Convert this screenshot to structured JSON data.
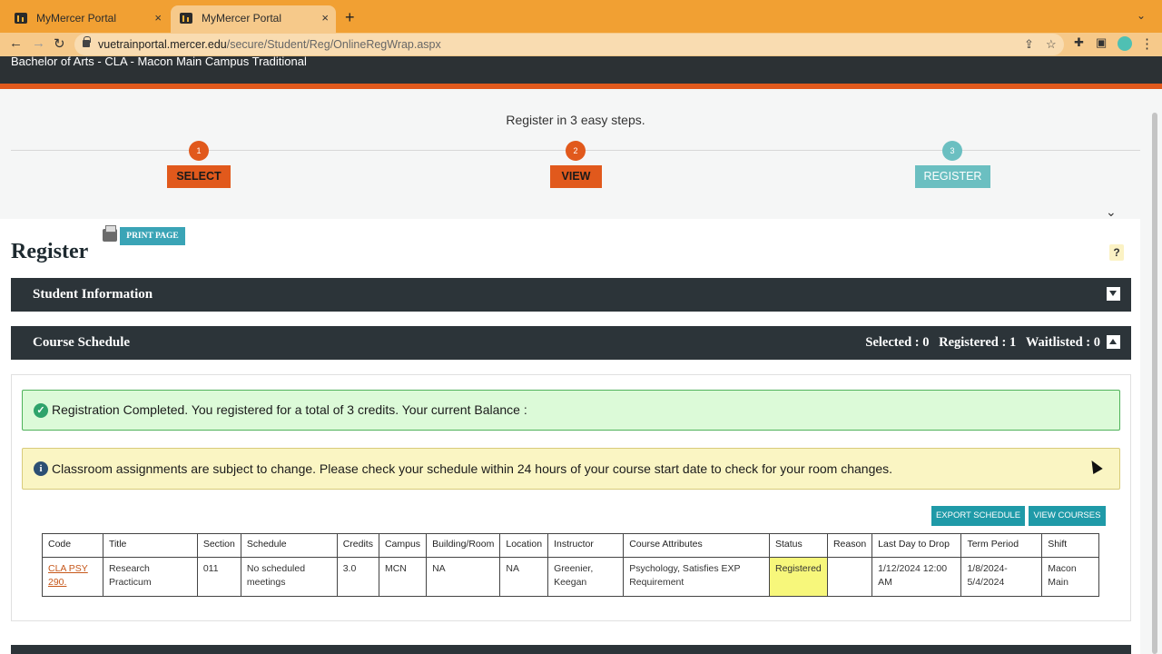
{
  "browser": {
    "tabs": [
      {
        "title": "MyMercer Portal"
      },
      {
        "title": "MyMercer Portal"
      }
    ],
    "new_tab": "+",
    "tab_close": "×",
    "url_host": "vuetrainportal.mercer.edu",
    "url_path": "/secure/Student/Reg/OnlineRegWrap.aspx"
  },
  "header": {
    "program": "Bachelor of Arts - CLA - Macon Main Campus Traditional"
  },
  "steps": {
    "title": "Register in 3 easy steps.",
    "items": [
      {
        "num": "1",
        "label": "SELECT"
      },
      {
        "num": "2",
        "label": "VIEW"
      },
      {
        "num": "3",
        "label": "REGISTER"
      }
    ]
  },
  "page": {
    "print_label": "PRINT PAGE",
    "title": "Register",
    "help": "?"
  },
  "student_info": {
    "title": "Student Information"
  },
  "course_schedule": {
    "title": "Course Schedule",
    "selected": "Selected : 0",
    "registered": "Registered : 1",
    "waitlisted": "Waitlisted : 0"
  },
  "alerts": {
    "success": "Registration Completed. You registered for a total of 3 credits. Your current Balance :",
    "info": "Classroom assignments are subject to change. Please check your schedule within 24 hours of your course start date to check for your room changes."
  },
  "actions": {
    "export": "EXPORT SCHEDULE",
    "view": "VIEW COURSES"
  },
  "table": {
    "headers": [
      "Code",
      "Title",
      "Section",
      "Schedule",
      "Credits",
      "Campus",
      "Building/Room",
      "Location",
      "Instructor",
      "Course Attributes",
      "Status",
      "Reason",
      "Last Day to Drop",
      "Term Period",
      "Shift"
    ],
    "rows": [
      {
        "code": "CLA PSY 290.",
        "title": "Research Practicum",
        "section": "011",
        "schedule": "No scheduled meetings",
        "credits": "3.0",
        "campus": "MCN",
        "building": "NA",
        "location": "NA",
        "instructor": "Greenier, Keegan",
        "attributes": "Psychology, Satisfies EXP Requirement",
        "status": "Registered",
        "reason": "",
        "last_drop": "1/12/2024 12:00 AM",
        "term": "1/8/2024-5/4/2024",
        "shift": "Macon Main"
      }
    ]
  },
  "colors": {
    "accent_orange": "#e1591c",
    "accent_teal": "#6bbfc1",
    "dark_bar": "#2c3439",
    "success_bg": "#dcfad8",
    "info_bg": "#faf5c3"
  }
}
